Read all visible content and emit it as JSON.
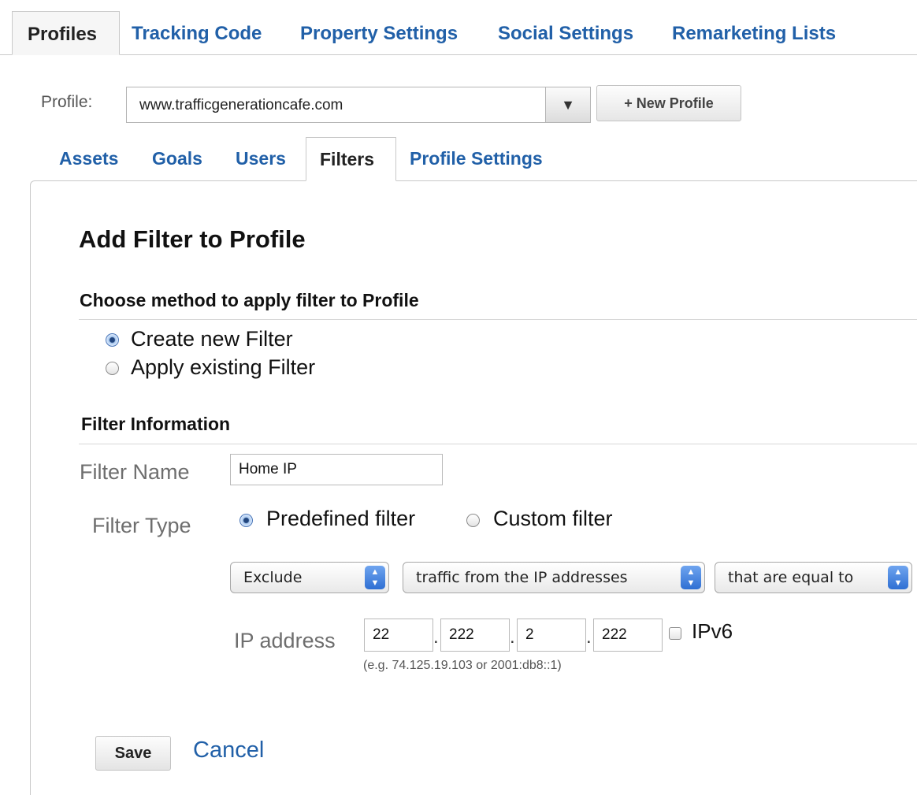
{
  "top_tabs": [
    "Profiles",
    "Tracking Code",
    "Property Settings",
    "Social Settings",
    "Remarketing Lists"
  ],
  "profile": {
    "label": "Profile:",
    "selected": "www.trafficgenerationcafe.com",
    "dropdown_glyph": "▼",
    "new_profile_label": "+ New Profile"
  },
  "sub_tabs": [
    "Assets",
    "Goals",
    "Users",
    "Filters",
    "Profile Settings"
  ],
  "page_title": "Add Filter to Profile",
  "method": {
    "heading": "Choose method to apply filter to Profile",
    "options": [
      "Create new Filter",
      "Apply existing Filter"
    ],
    "selected_index": 0
  },
  "filter_info": {
    "heading": "Filter Information",
    "name_label": "Filter Name",
    "name_value": "Home IP",
    "type_label": "Filter Type",
    "type_options": [
      "Predefined filter",
      "Custom filter"
    ],
    "type_selected_index": 0,
    "dropdowns": [
      "Exclude",
      "traffic from the IP addresses",
      "that are equal to"
    ],
    "ip_label": "IP address",
    "ip_octets": [
      "22",
      "222",
      "2",
      "222"
    ],
    "ip_dot": ".",
    "ipv6_label": "IPv6",
    "ip_hint": "(e.g. 74.125.19.103 or 2001:db8::1)"
  },
  "actions": {
    "save_label": "Save",
    "cancel_label": "Cancel"
  }
}
